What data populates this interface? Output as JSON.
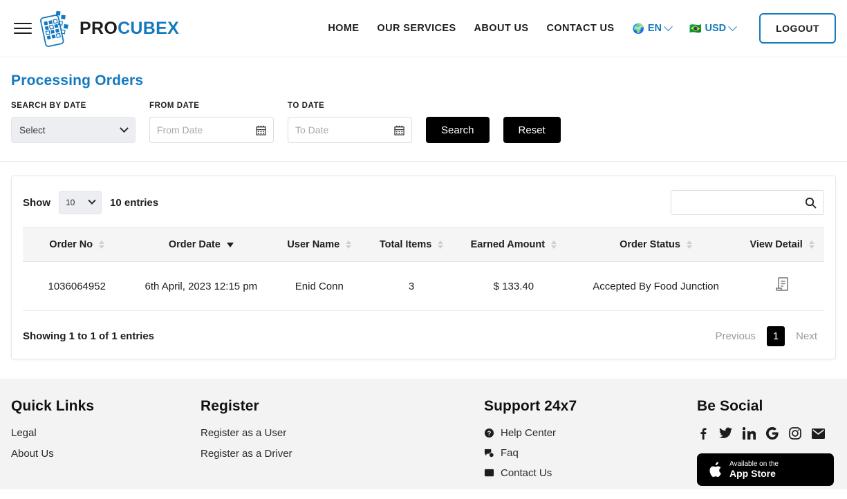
{
  "header": {
    "brand_prefix": "PRO",
    "brand_suffix": "CUBEX",
    "nav": [
      {
        "label": "HOME"
      },
      {
        "label": "OUR SERVICES"
      },
      {
        "label": "ABOUT US"
      },
      {
        "label": "CONTACT US"
      }
    ],
    "language": {
      "icon": "globe-icon",
      "label": "EN"
    },
    "currency": {
      "icon": "flag-icon",
      "label": "USD"
    },
    "logout_label": "LOGOUT"
  },
  "page": {
    "title": "Processing Orders"
  },
  "filters": {
    "search_by_date_label": "SEARCH BY DATE",
    "search_by_date_value": "Select",
    "from_date_label": "FROM DATE",
    "from_date_value": "",
    "from_date_placeholder": "From Date",
    "to_date_label": "TO DATE",
    "to_date_value": "",
    "to_date_placeholder": "To Date",
    "search_button": "Search",
    "reset_button": "Reset"
  },
  "table": {
    "show_label": "Show",
    "page_length": "10",
    "entries_label": "10 entries",
    "search_value": "",
    "search_placeholder": "",
    "columns": [
      {
        "label": "Order No",
        "sort": "none"
      },
      {
        "label": "Order Date",
        "sort": "desc"
      },
      {
        "label": "User Name",
        "sort": "none"
      },
      {
        "label": "Total Items",
        "sort": "none"
      },
      {
        "label": "Earned Amount",
        "sort": "none"
      },
      {
        "label": "Order Status",
        "sort": "none"
      },
      {
        "label": "View Detail",
        "sort": "none"
      }
    ],
    "rows": [
      {
        "order_no": "1036064952",
        "order_date": "6th April, 2023 12:15 pm",
        "user_name": "Enid Conn",
        "total_items": "3",
        "earned_amount": "$ 133.40",
        "order_status": "Accepted By Food Junction",
        "view_detail_icon": "receipt-icon"
      }
    ],
    "showing_text": "Showing 1 to 1 of 1 entries",
    "pagination": {
      "previous_label": "Previous",
      "current_page": "1",
      "next_label": "Next"
    }
  },
  "footer": {
    "quick_links": {
      "title": "Quick Links",
      "items": [
        {
          "label": "Legal"
        },
        {
          "label": "About Us"
        }
      ]
    },
    "register": {
      "title": "Register",
      "items": [
        {
          "label": "Register as a User"
        },
        {
          "label": "Register as a Driver"
        }
      ]
    },
    "support": {
      "title": "Support 24x7",
      "items": [
        {
          "label": "Help Center",
          "icon": "question-circle-icon"
        },
        {
          "label": "Faq",
          "icon": "faq-icon"
        },
        {
          "label": "Contact Us",
          "icon": "contact-icon"
        }
      ]
    },
    "social": {
      "title": "Be Social",
      "icons": [
        {
          "name": "facebook-icon"
        },
        {
          "name": "twitter-icon"
        },
        {
          "name": "linkedin-icon"
        },
        {
          "name": "google-icon"
        },
        {
          "name": "instagram-icon"
        },
        {
          "name": "email-icon"
        }
      ],
      "store_button": {
        "sub": "Available on the",
        "main": "App Store",
        "icon": "apple-icon"
      }
    }
  },
  "colors": {
    "brand_blue": "#1479bf",
    "black": "#000000",
    "header_bg": "#f5f5f5",
    "footer_bg": "#f3f3f3"
  }
}
